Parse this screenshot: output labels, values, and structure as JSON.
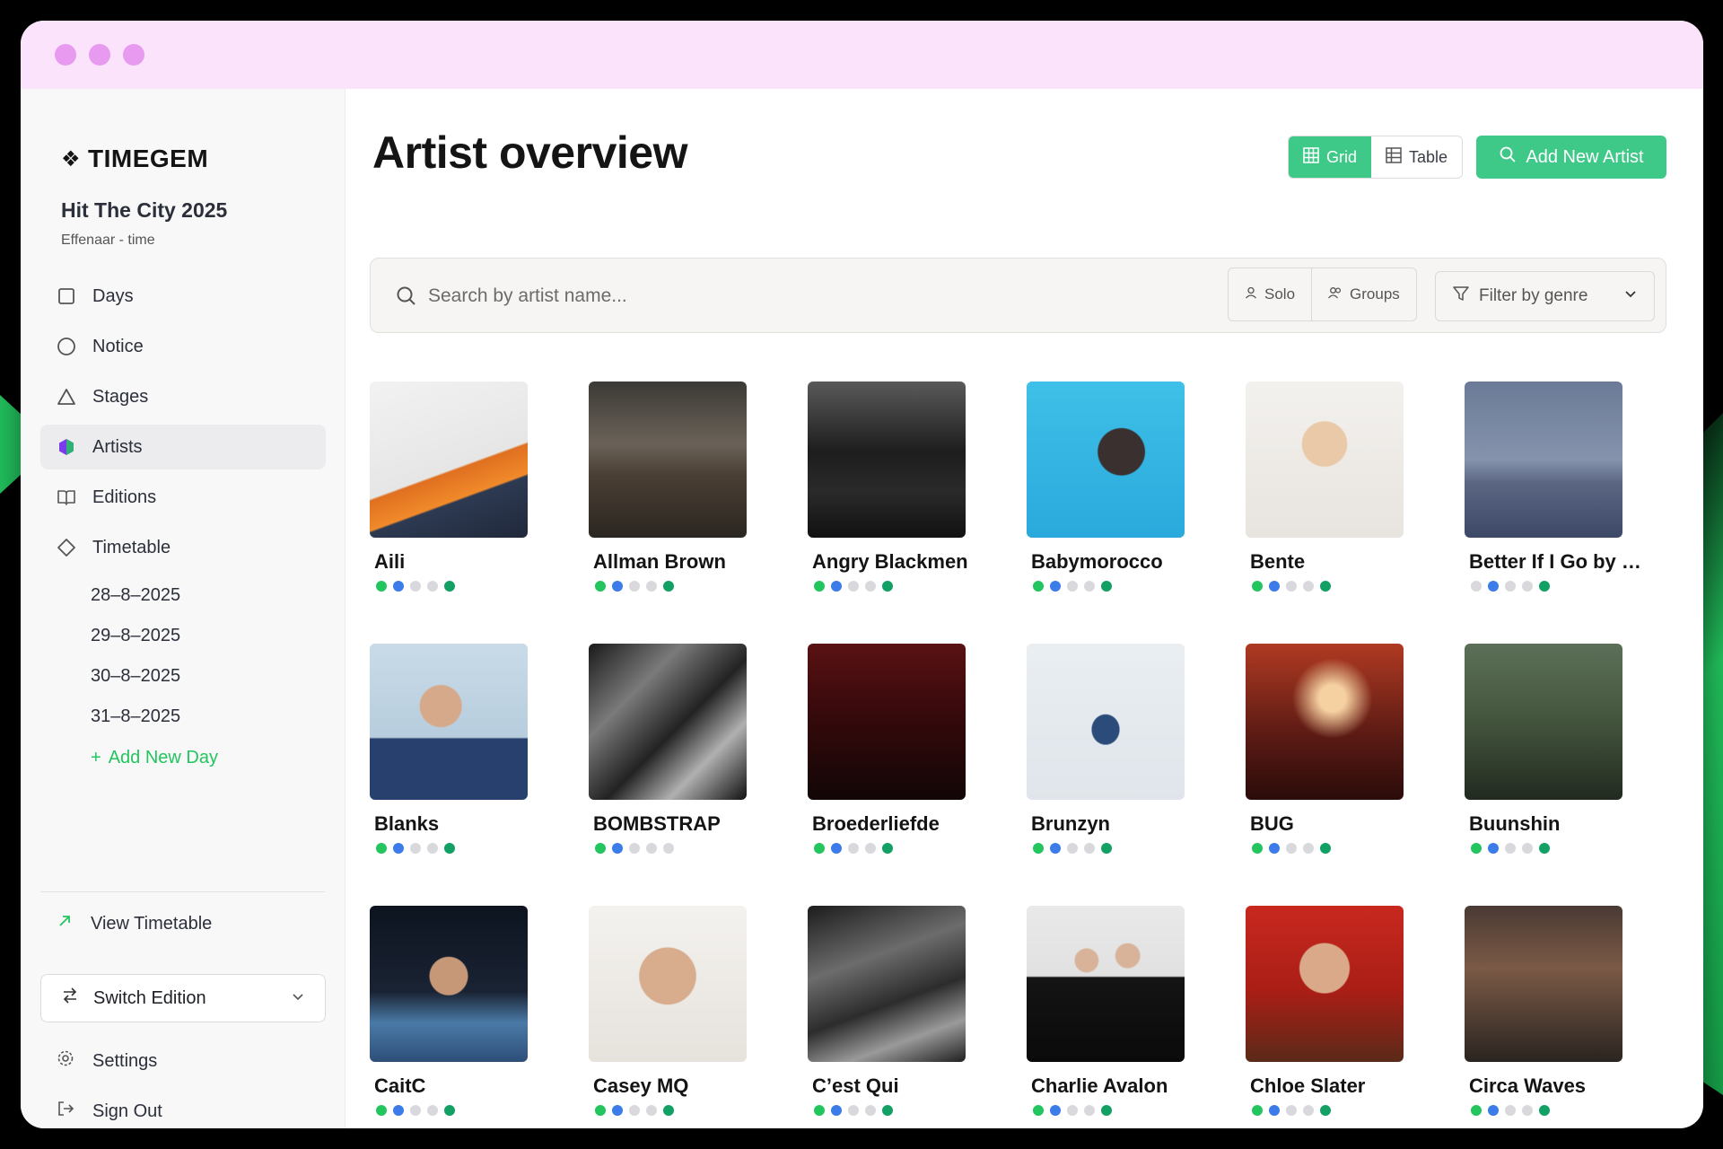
{
  "sidebar": {
    "logo": "TIMEGEM",
    "event_name": "Hit The City 2025",
    "event_sub": "Effenaar - time",
    "nav": [
      {
        "label": "Days",
        "icon": "square-icon"
      },
      {
        "label": "Notice",
        "icon": "circle-icon"
      },
      {
        "label": "Stages",
        "icon": "triangle-icon"
      },
      {
        "label": "Artists",
        "icon": "hexagon-icon",
        "active": true
      },
      {
        "label": "Editions",
        "icon": "book-icon"
      },
      {
        "label": "Timetable",
        "icon": "diamond-icon"
      }
    ],
    "days": [
      "28–8–2025",
      "29–8–2025",
      "30–8–2025",
      "31–8–2025"
    ],
    "add_day": "Add New Day",
    "view_timetable": "View Timetable",
    "switch_edition": "Switch Edition",
    "settings": "Settings",
    "sign_out": "Sign Out"
  },
  "header": {
    "title": "Artist overview",
    "grid_label": "Grid",
    "table_label": "Table",
    "add_artist": "Add New Artist"
  },
  "search": {
    "placeholder": "Search by artist name...",
    "solo": "Solo",
    "groups": "Groups",
    "genre": "Filter by genre"
  },
  "colors": {
    "accent": "#3fc989",
    "status_green": "#22c55e",
    "status_blue": "#3b7ce8",
    "status_grey": "#d9d9dd",
    "status_dark_green": "#12a064"
  },
  "artists": [
    {
      "name": "Aili",
      "status": [
        "g",
        "b",
        "x",
        "x",
        "d"
      ]
    },
    {
      "name": "Allman Brown",
      "status": [
        "g",
        "b",
        "x",
        "x",
        "d"
      ]
    },
    {
      "name": "Angry Blackmen",
      "status": [
        "g",
        "b",
        "x",
        "x",
        "d"
      ]
    },
    {
      "name": "Babymorocco",
      "status": [
        "g",
        "b",
        "x",
        "x",
        "d"
      ]
    },
    {
      "name": "Bente",
      "status": [
        "g",
        "b",
        "x",
        "x",
        "d"
      ]
    },
    {
      "name": "Better If I Go by D...",
      "status": [
        "x",
        "b",
        "x",
        "x",
        "d"
      ]
    },
    {
      "name": "Blanks",
      "status": [
        "g",
        "b",
        "x",
        "x",
        "d"
      ]
    },
    {
      "name": "BOMBSTRAP",
      "status": [
        "g",
        "b",
        "x",
        "x",
        "x"
      ]
    },
    {
      "name": "Broederliefde",
      "status": [
        "g",
        "b",
        "x",
        "x",
        "d"
      ]
    },
    {
      "name": "Brunzyn",
      "status": [
        "g",
        "b",
        "x",
        "x",
        "d"
      ]
    },
    {
      "name": "BUG",
      "status": [
        "g",
        "b",
        "x",
        "x",
        "d"
      ]
    },
    {
      "name": "Buunshin",
      "status": [
        "g",
        "b",
        "x",
        "x",
        "d"
      ]
    },
    {
      "name": "CaitC",
      "status": [
        "g",
        "b",
        "x",
        "x",
        "d"
      ]
    },
    {
      "name": "Casey MQ",
      "status": [
        "g",
        "b",
        "x",
        "x",
        "d"
      ]
    },
    {
      "name": "C’est Qui",
      "status": [
        "g",
        "b",
        "x",
        "x",
        "d"
      ]
    },
    {
      "name": "Charlie Avalon",
      "status": [
        "g",
        "b",
        "x",
        "x",
        "d"
      ]
    },
    {
      "name": "Chloe Slater",
      "status": [
        "g",
        "b",
        "x",
        "x",
        "d"
      ]
    },
    {
      "name": "Circa Waves",
      "status": [
        "g",
        "b",
        "x",
        "x",
        "d"
      ]
    }
  ]
}
